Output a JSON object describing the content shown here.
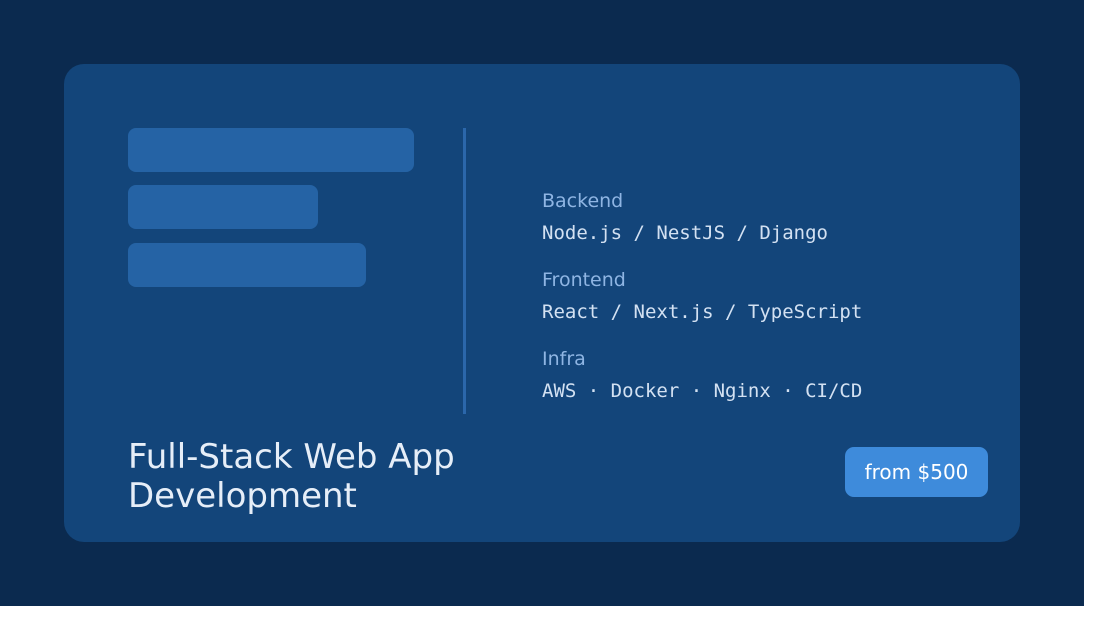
{
  "card": {
    "title_line1": "Full-Stack Web App",
    "title_line2": "Development",
    "price_label": "from $500"
  },
  "stack": [
    {
      "label": "Backend",
      "value": "Node.js / NestJS / Django"
    },
    {
      "label": "Frontend",
      "value": "React / Next.js / TypeScript"
    },
    {
      "label": "Infra",
      "value": "AWS · Docker · Nginx · CI/CD"
    }
  ],
  "colors": {
    "background": "#0b2a4f",
    "card": "#13457a",
    "placeholder_bar": "#2563a5",
    "accent": "#3e8bdb",
    "label": "#8fb5e3",
    "text": "#d3e1f2"
  }
}
